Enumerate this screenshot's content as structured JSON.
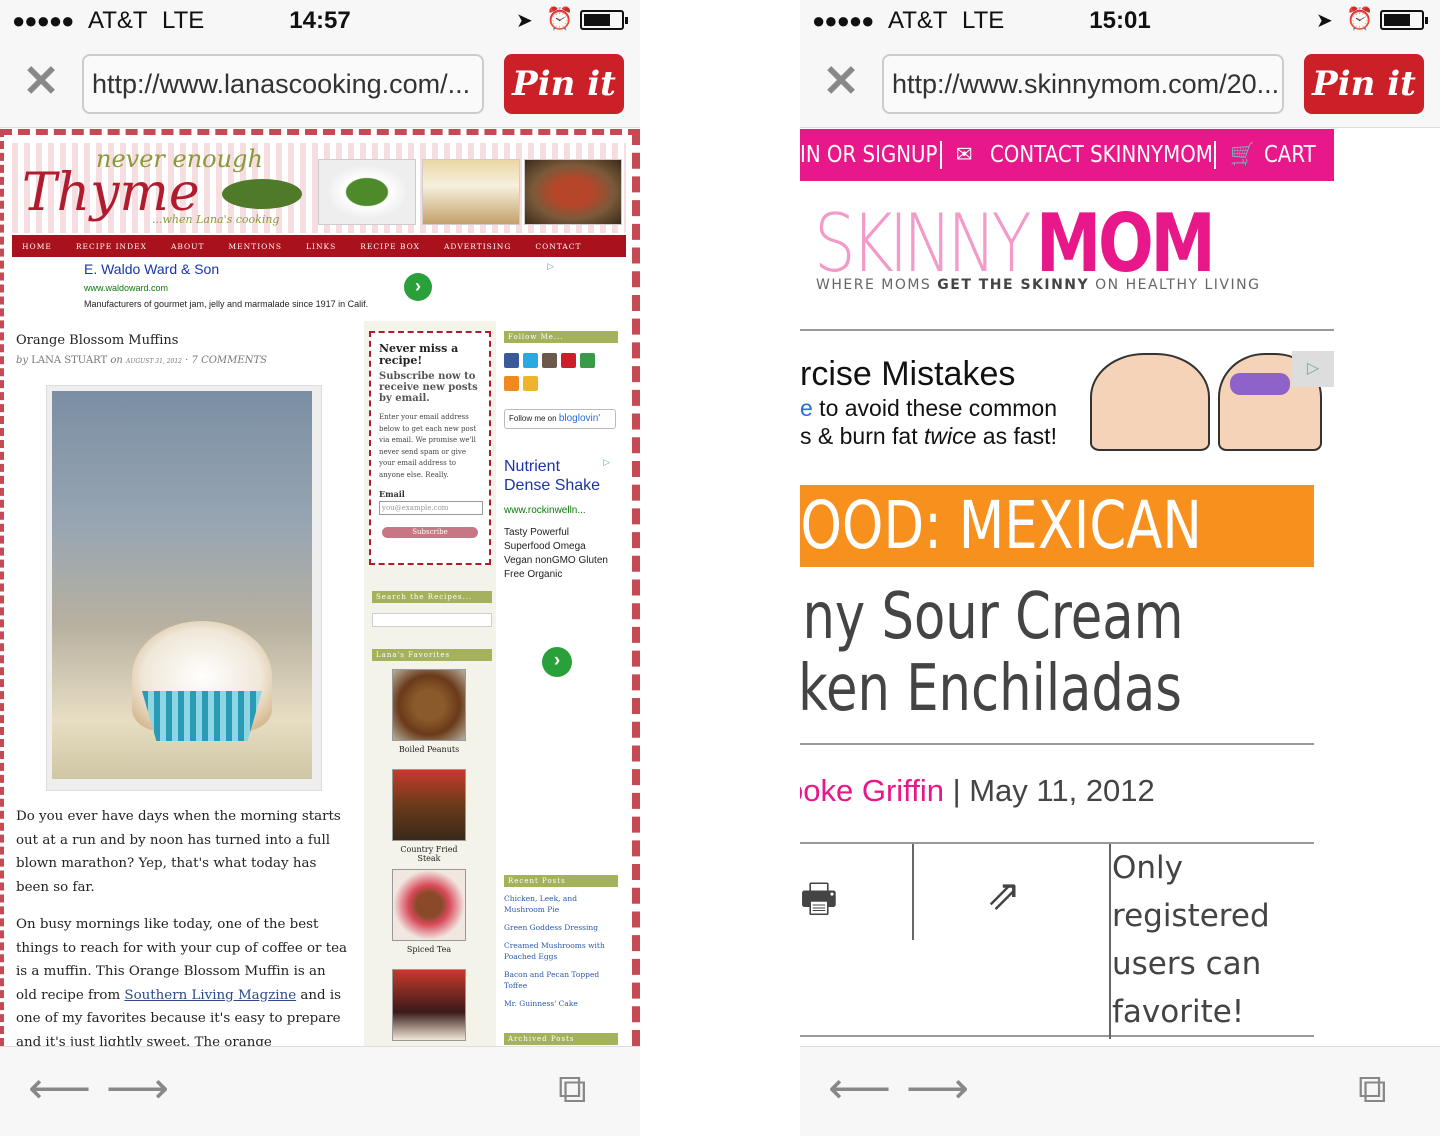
{
  "left": {
    "status": {
      "signal": "●●●●●",
      "carrier": "AT&T",
      "network": "LTE",
      "time": "14:57"
    },
    "url": "http://www.lanascooking.com/...",
    "pin_label": "Pin it",
    "site": {
      "title_top": "never enough",
      "title_main": "Thyme",
      "title_sub": "...when Lana's cooking",
      "nav": [
        "HOME",
        "RECIPE INDEX",
        "ABOUT",
        "MENTIONS",
        "LINKS",
        "RECIPE BOX",
        "ADVERTISING",
        "CONTACT"
      ],
      "ad": {
        "headline": "E. Waldo Ward & Son",
        "url": "www.waldoward.com",
        "desc": "Manufacturers of gourmet jam, jelly and marmalade since 1917 in Calif."
      },
      "post": {
        "title": "Orange Blossom Muffins",
        "by": "by",
        "author": "LANA STUART",
        "on": "on",
        "date": "AUGUST 31, 2012",
        "comments": "· 7 COMMENTS",
        "p1": "Do you ever have days when the morning starts out at a run and by noon has turned into a full blown marathon? Yep, that's what today has been so far.",
        "p2_a": "On busy mornings like today, one of the best things to reach for with your cup of coffee or tea is a muffin. This Orange Blossom Muffin is an old recipe from ",
        "p2_link": "Southern Living Magzine",
        "p2_b": " and is one of my favorites because it's easy to prepare and it's just lightly sweet. The orange marmalade"
      },
      "subscribe": {
        "heading": "Never miss a recipe!",
        "sub": "Subscribe now to receive new posts by email.",
        "body": "Enter your email address below to get each new post via email. We promise we'll never send spam or give your email address to anyone else. Really.",
        "email_label": "Email",
        "email_placeholder": "you@example.com",
        "button": "Subscribe"
      },
      "search_heading": "Search the Recipes...",
      "favorites_heading": "Lana's Favorites",
      "favorites": [
        "Boiled Peanuts",
        "Country Fried Steak",
        "Spiced Tea"
      ],
      "follow_heading": "Follow Me...",
      "bloglovin_prefix": "Follow me on",
      "bloglovin_brand": "bloglovin'",
      "right_ad": {
        "headline": "Nutrient Dense Shake",
        "url": "www.rockinwelln...",
        "desc": "Tasty Powerful Superfood Omega Vegan nonGMO Gluten Free Organic"
      },
      "recent_heading": "Recent Posts",
      "recent": [
        "Chicken, Leek, and Mushroom Pie",
        "Green Goddess Dressing",
        "Creamed Mushrooms with Poached Eggs",
        "Bacon and Pecan Topped Toffee",
        "Mr. Guinness' Cake"
      ],
      "archived_heading": "Archived Posts"
    }
  },
  "right": {
    "status": {
      "signal": "●●●●●",
      "carrier": "AT&T",
      "network": "LTE",
      "time": "15:01"
    },
    "url": "http://www.skinnymom.com/20...",
    "pin_label": "Pin it",
    "site": {
      "topbar": {
        "login": "IN OR SIGNUP",
        "contact": "CONTACT SKINNYMOM",
        "cart": "CART"
      },
      "logo_a": "SKINNY",
      "logo_b": "MOM",
      "tagline_a": "WHERE MOMS",
      "tagline_b": "GET THE SKINNY",
      "tagline_c": "ON HEALTHY LIVING",
      "ad": {
        "line1": "rcise Mistakes",
        "line2_link": "e",
        "line2": " to avoid these common",
        "line3_a": "s & burn fat ",
        "line3_em": "twice",
        "line3_b": " as fast!"
      },
      "category": "FOOD: MEXICAN",
      "headline_1": "nny Sour Cream",
      "headline_2": "cken Enchiladas",
      "author": "ooke Griffin",
      "separator": " | ",
      "date": "May 11, 2012",
      "favorite_note": "Only registered users can favorite!"
    }
  },
  "colors": {
    "pin": "#cb2027",
    "skinny_pink": "#e8178a",
    "category_orange": "#f8901e",
    "thyme_red": "#a9111c"
  }
}
